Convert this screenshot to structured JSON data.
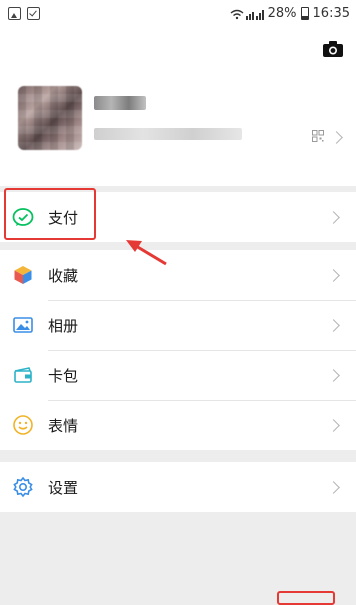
{
  "status_bar": {
    "battery_text": "28%",
    "time": "16:35"
  },
  "profile": {
    "camera_icon": "camera-icon",
    "qr_icon": "qr-code-icon"
  },
  "menu": {
    "pay": {
      "label": "支付",
      "icon": "wechat-pay-icon",
      "icon_color": "#07c160"
    },
    "favorites": {
      "label": "收藏",
      "icon": "cube-icon"
    },
    "album": {
      "label": "相册",
      "icon": "photo-album-icon"
    },
    "cards": {
      "label": "卡包",
      "icon": "card-wallet-icon"
    },
    "stickers": {
      "label": "表情",
      "icon": "smiley-icon"
    },
    "settings": {
      "label": "设置",
      "icon": "gear-icon"
    }
  },
  "annotation": {
    "highlight_color": "#e53935"
  }
}
